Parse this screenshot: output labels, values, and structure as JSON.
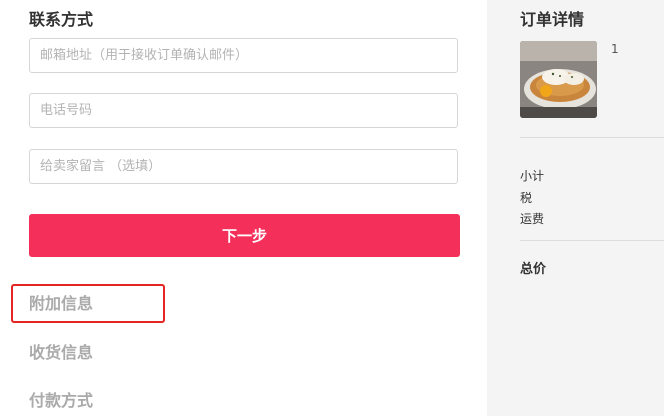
{
  "contact": {
    "title": "联系方式",
    "email_placeholder": "邮箱地址（用于接收订单确认邮件）",
    "phone_placeholder": "电话号码",
    "note_placeholder": "给卖家留言 （选填）",
    "next_label": "下一步"
  },
  "steps": {
    "extra_info": "附加信息",
    "shipping_info": "收货信息",
    "payment_method": "付款方式"
  },
  "order": {
    "title": "订单详情",
    "quantity": "1",
    "subtotal_label": "小计",
    "tax_label": "税",
    "shipping_label": "运费",
    "total_label": "总价"
  },
  "colors": {
    "accent": "#f42f5a",
    "highlight": "#e52521",
    "sidebar_bg": "#f4f4f4"
  }
}
